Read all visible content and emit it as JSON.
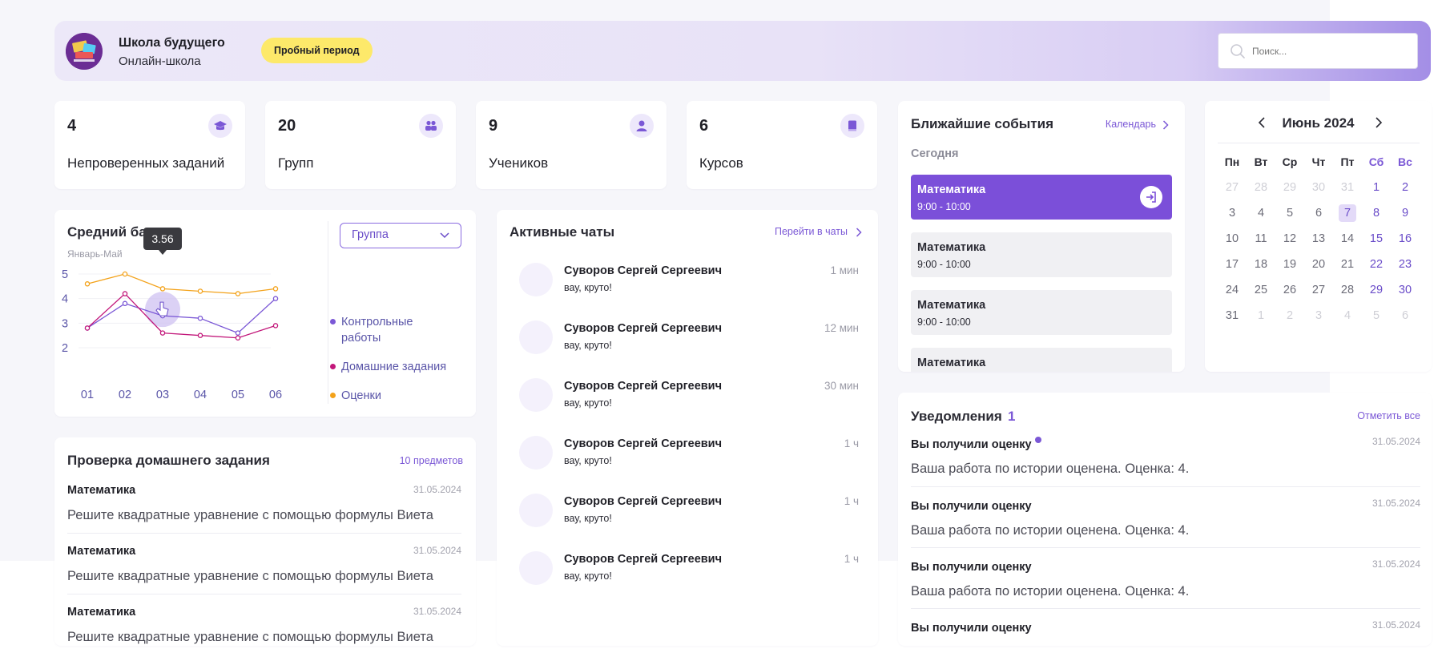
{
  "header": {
    "school_name": "Школа будущего",
    "school_subtitle": "Онлайн-школа",
    "trial_badge": "Пробный период",
    "search_placeholder": "Поиск..."
  },
  "stats": [
    {
      "value": "4",
      "label": "Непроверенных заданий",
      "icon": "graduation-cap-icon"
    },
    {
      "value": "20",
      "label": "Групп",
      "icon": "group-icon"
    },
    {
      "value": "9",
      "label": "Учеников",
      "icon": "user-icon"
    },
    {
      "value": "6",
      "label": "Курсов",
      "icon": "book-icon"
    }
  ],
  "avg_score": {
    "title": "Средний балл",
    "period": "Январь-Май",
    "select_value": "Группа",
    "tooltip": "3.56"
  },
  "chart_data": {
    "type": "line",
    "title": "Средний балл",
    "x": [
      "01",
      "02",
      "03",
      "04",
      "05",
      "06"
    ],
    "y_ticks": [
      "5",
      "4",
      "3",
      "2"
    ],
    "ylim": [
      2,
      5
    ],
    "grid": true,
    "legend_placement": "right",
    "series": [
      {
        "name": "Контрольные работы",
        "color": "#7b58d6",
        "values": [
          2.8,
          3.8,
          3.3,
          3.2,
          2.6,
          4.0
        ]
      },
      {
        "name": "Домашние задания",
        "color": "#c2177a",
        "values": [
          2.8,
          4.2,
          2.6,
          2.5,
          2.4,
          2.9
        ]
      },
      {
        "name": "Оценки",
        "color": "#f3a21a",
        "values": [
          4.6,
          5.0,
          4.4,
          4.3,
          4.2,
          4.4
        ]
      }
    ]
  },
  "homework": {
    "title": "Проверка домашнего задания",
    "count_link": "10 предметов",
    "items": [
      {
        "subject": "Математика",
        "date": "31.05.2024",
        "text": "Решите квадратные уравнение с помощью формулы Виета"
      },
      {
        "subject": "Математика",
        "date": "31.05.2024",
        "text": "Решите квадратные уравнение с помощью формулы Виета"
      },
      {
        "subject": "Математика",
        "date": "31.05.2024",
        "text": "Решите квадратные уравнение с помощью формулы Виета"
      }
    ]
  },
  "chats": {
    "title": "Активные чаты",
    "link": "Перейти в чаты",
    "items": [
      {
        "name": "Суворов Сергей Сергеевич",
        "msg": "вау, круто!",
        "time": "1 мин"
      },
      {
        "name": "Суворов Сергей Сергеевич",
        "msg": "вау, круто!",
        "time": "12 мин"
      },
      {
        "name": "Суворов Сергей Сергеевич",
        "msg": "вау, круто!",
        "time": "30 мин"
      },
      {
        "name": "Суворов Сергей Сергеевич",
        "msg": "вау, круто!",
        "time": "1 ч"
      },
      {
        "name": "Суворов Сергей Сергеевич",
        "msg": "вау, круто!",
        "time": "1 ч"
      },
      {
        "name": "Суворов Сергей Сергеевич",
        "msg": "вау, круто!",
        "time": "1 ч"
      }
    ]
  },
  "events": {
    "title": "Ближайшие события",
    "link": "Календарь",
    "today": "Сегодня",
    "items": [
      {
        "title": "Математика",
        "time": "9:00 - 10:00"
      },
      {
        "title": "Математика",
        "time": "9:00 - 10:00"
      },
      {
        "title": "Математика",
        "time": "9:00 - 10:00"
      },
      {
        "title": "Математика",
        "time": ""
      }
    ]
  },
  "calendar": {
    "month": "Июнь 2024",
    "weekdays": [
      "Пн",
      "Вт",
      "Ср",
      "Чт",
      "Пт",
      "Сб",
      "Вс"
    ],
    "weeks": [
      [
        "27",
        "28",
        "29",
        "30",
        "31",
        "1",
        "2"
      ],
      [
        "3",
        "4",
        "5",
        "6",
        "7",
        "8",
        "9"
      ],
      [
        "10",
        "11",
        "12",
        "13",
        "14",
        "15",
        "16"
      ],
      [
        "17",
        "18",
        "19",
        "20",
        "21",
        "22",
        "23"
      ],
      [
        "24",
        "25",
        "26",
        "27",
        "28",
        "29",
        "30"
      ],
      [
        "31",
        "1",
        "2",
        "3",
        "4",
        "5",
        "6"
      ]
    ],
    "today": "7"
  },
  "notifications": {
    "title": "Уведомления",
    "count": "1",
    "link": "Отметить все",
    "items": [
      {
        "title": "Вы получили оценку",
        "date": "31.05.2024",
        "text": "Ваша работа по истории оценена. Оценка: 4."
      },
      {
        "title": "Вы получили оценку",
        "date": "31.05.2024",
        "text": "Ваша работа по истории оценена. Оценка: 4."
      },
      {
        "title": "Вы получили оценку",
        "date": "31.05.2024",
        "text": "Ваша работа по истории оценена. Оценка: 4."
      },
      {
        "title": "Вы получили оценку",
        "date": "31.05.2024",
        "text": ""
      }
    ]
  },
  "colors": {
    "accent": "#7b58d6",
    "trial": "#fde96a",
    "background": "#f6f6fa"
  }
}
